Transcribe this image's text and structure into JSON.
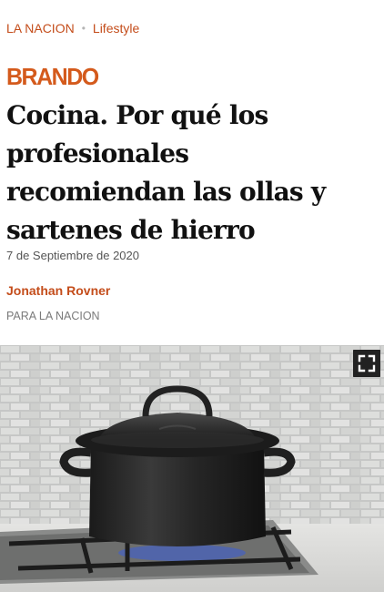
{
  "breadcrumb": {
    "site": "LA NACION",
    "section": "Lifestyle"
  },
  "brand": "BRANDO",
  "article": {
    "title": "Cocina. Por qué los profesionales recomiendan las ollas y sartenes de hierro",
    "date": "7 de Septiembre de 2020",
    "author": "Jonathan Rovner",
    "source": "PARA LA NACION"
  },
  "hero_image": {
    "subject": "Cast iron dutch oven with lid on a gas stove burner in front of a brick tile backsplash",
    "expand_icon": "fullscreen-icon"
  },
  "colors": {
    "accent": "#c44d1b",
    "brand": "#d45a1c",
    "title": "#111111",
    "muted": "#7a7a7a"
  }
}
